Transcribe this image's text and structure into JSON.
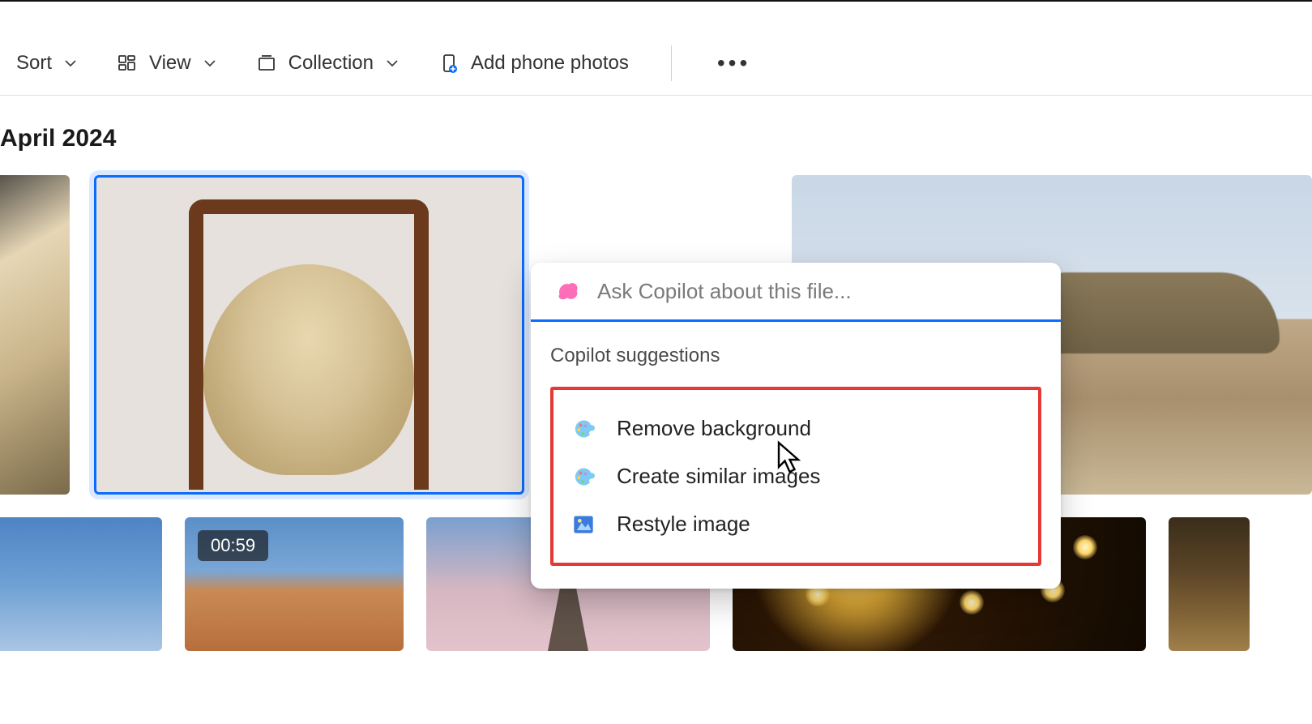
{
  "toolbar": {
    "sort_label": "Sort",
    "view_label": "View",
    "collection_label": "Collection",
    "add_phone_label": "Add phone photos"
  },
  "section": {
    "title": "April 2024"
  },
  "thumbnails": {
    "video_badge": "00:59"
  },
  "popup": {
    "placeholder": "Ask Copilot about this file...",
    "subtitle": "Copilot suggestions",
    "suggestions": [
      {
        "label": "Remove background",
        "icon": "palette"
      },
      {
        "label": "Create similar images",
        "icon": "palette"
      },
      {
        "label": "Restyle image",
        "icon": "image"
      }
    ]
  }
}
